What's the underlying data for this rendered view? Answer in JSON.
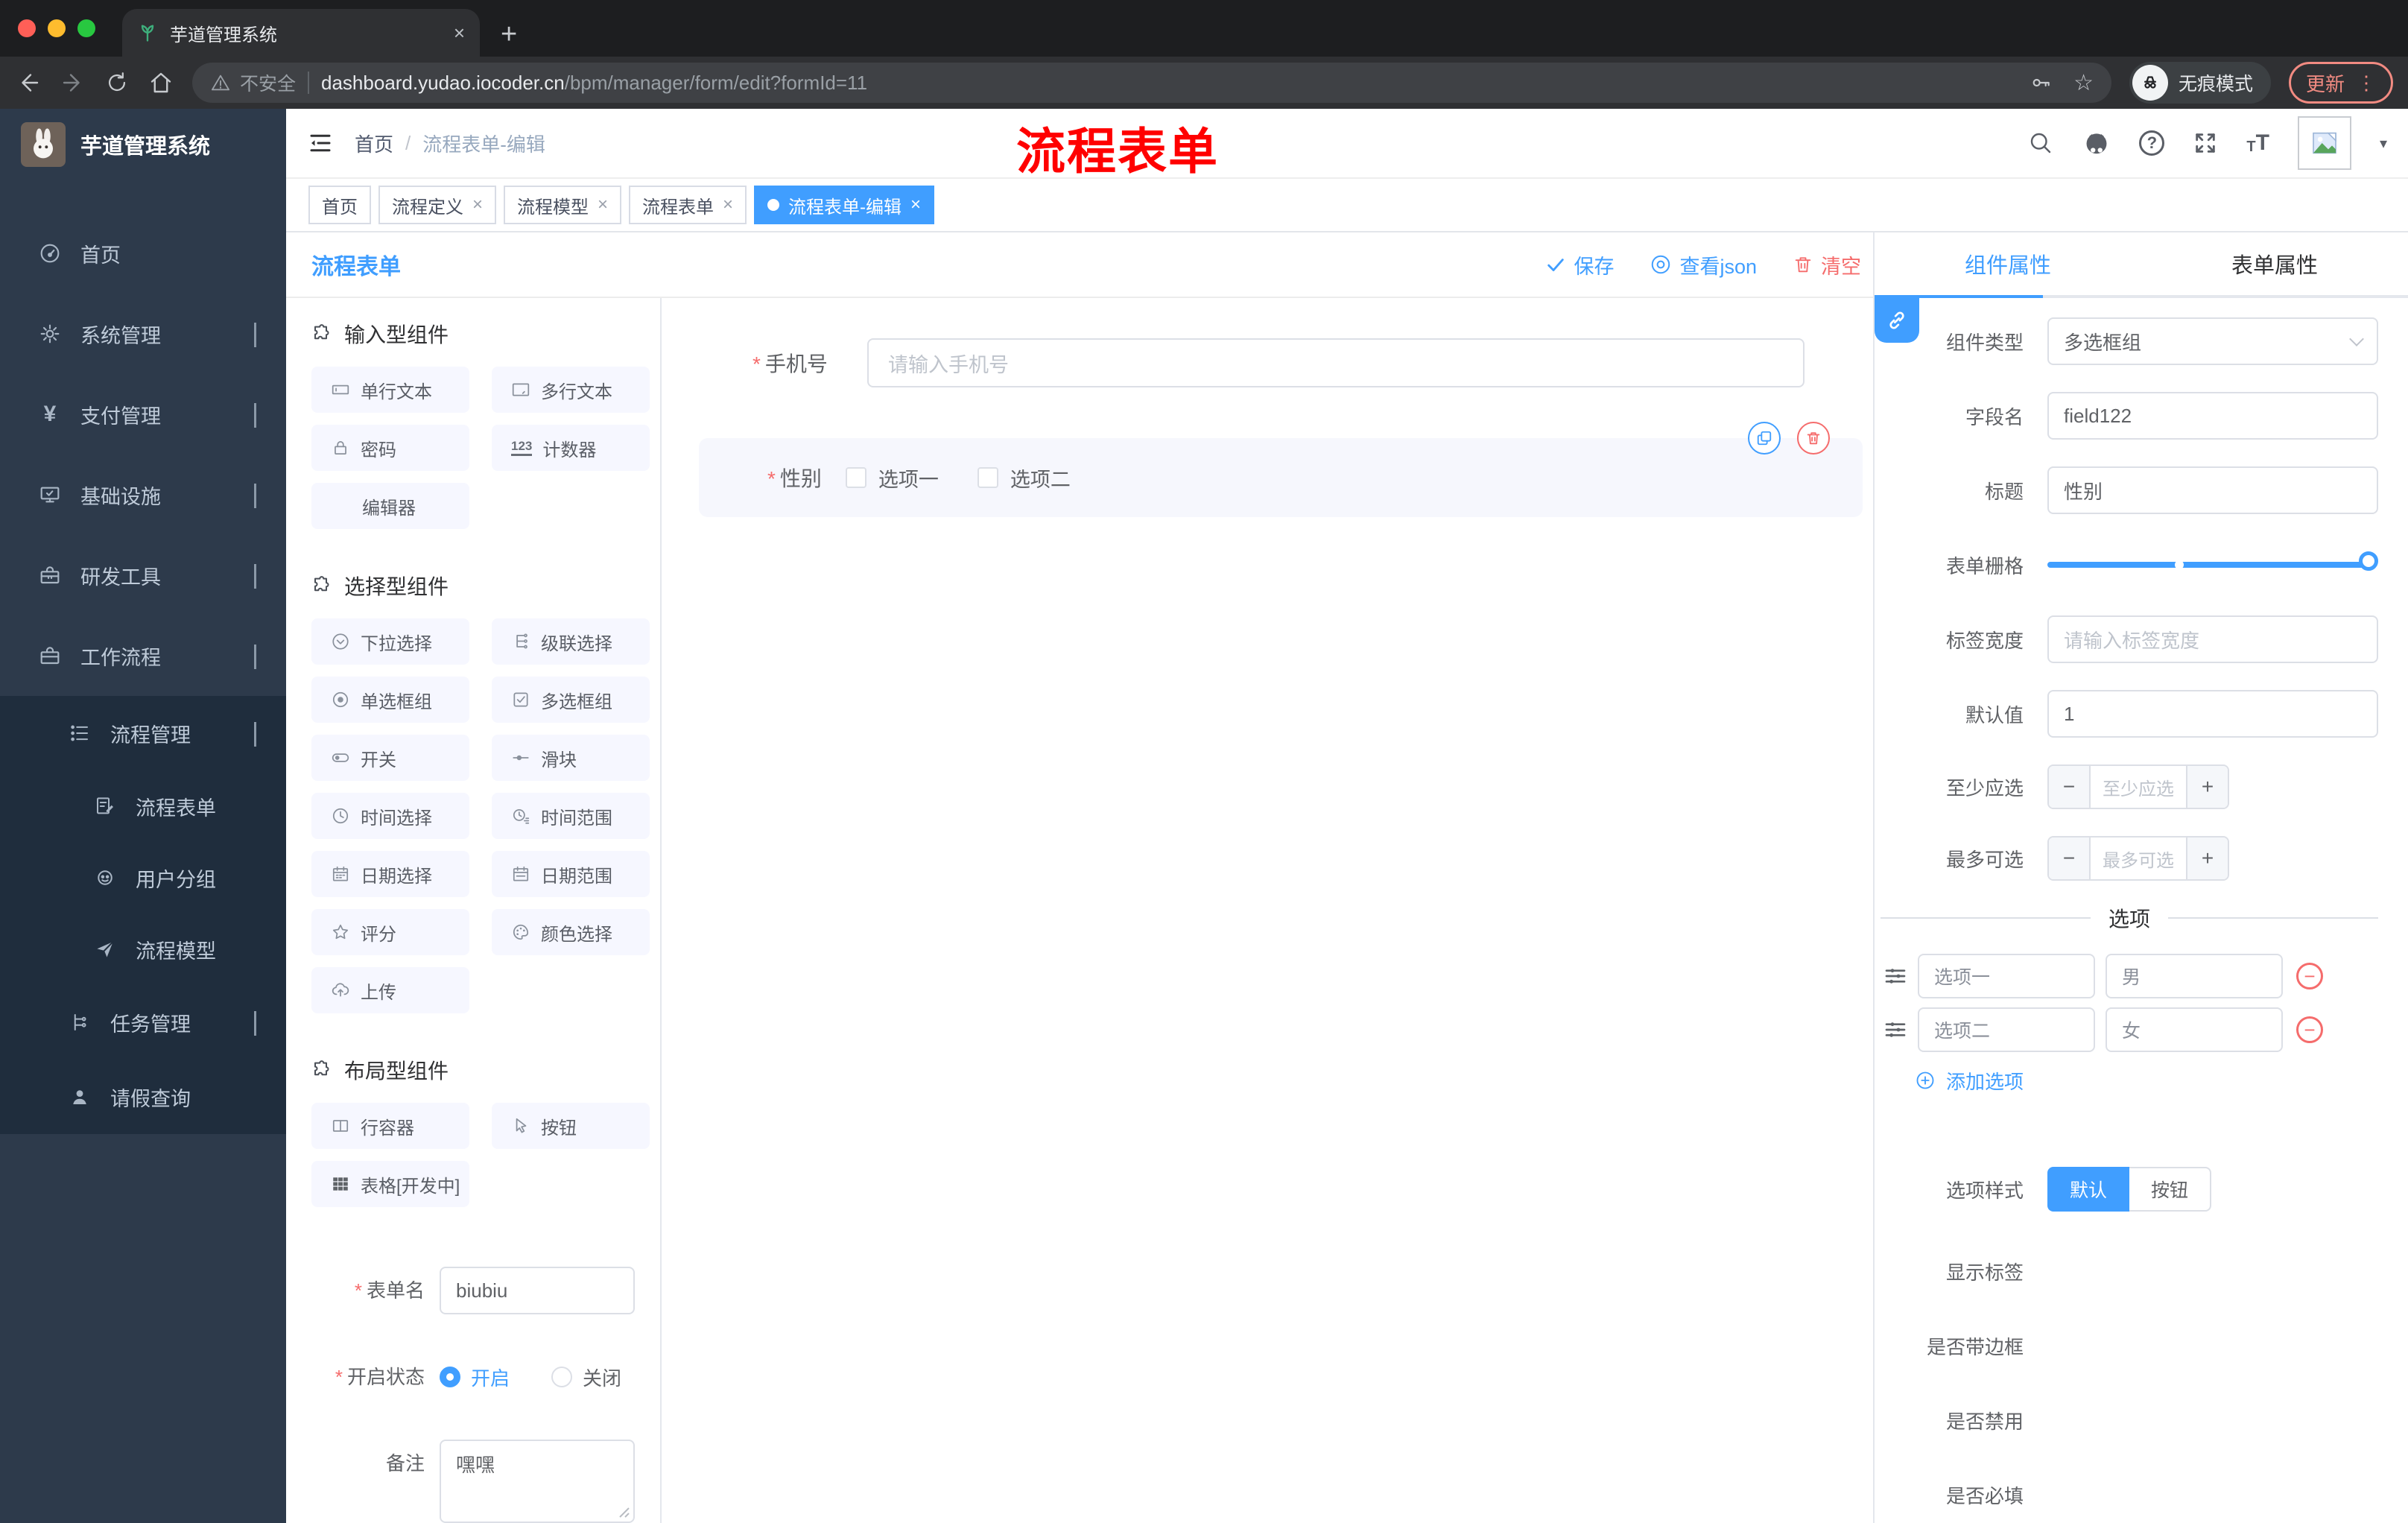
{
  "browser": {
    "tab_title": "芋道管理系统",
    "insecure": "不安全",
    "url_host": "dashboard.yudao.iocoder.cn",
    "url_path": "/bpm/manager/form/edit?formId=11",
    "incognito": "无痕模式",
    "update": "更新"
  },
  "icons": {
    "close": "×",
    "minus": "−",
    "plus": "+",
    "dots": "⋮",
    "star": "☆",
    "question": "?",
    "caret": "▾",
    "counter": "123",
    "yen": "¥",
    "font_big": "T",
    "font_small": "T",
    "warning": "!"
  },
  "sidebar": {
    "app_title": "芋道管理系统",
    "menu": [
      {
        "label": "首页"
      },
      {
        "label": "系统管理"
      },
      {
        "label": "支付管理"
      },
      {
        "label": "基础设施"
      },
      {
        "label": "研发工具"
      },
      {
        "label": "工作流程"
      }
    ],
    "submenu": [
      {
        "label": "流程管理"
      },
      {
        "label": "流程表单"
      },
      {
        "label": "用户分组"
      },
      {
        "label": "流程模型"
      },
      {
        "label": "任务管理"
      },
      {
        "label": "请假查询"
      }
    ]
  },
  "header": {
    "breadcrumb_home": "首页",
    "breadcrumb_sep": "/",
    "breadcrumb_current": "流程表单-编辑",
    "watermark": "流程表单"
  },
  "tags": {
    "t0": "首页",
    "t1": "流程定义",
    "t2": "流程模型",
    "t3": "流程表单",
    "t4": "流程表单-编辑"
  },
  "toolbar": {
    "title": "流程表单",
    "save": "保存",
    "view_json": "查看json",
    "clear": "清空"
  },
  "components": {
    "g1_title": "输入型组件",
    "g1": [
      "单行文本",
      "多行文本",
      "密码",
      "计数器",
      "编辑器"
    ],
    "g2_title": "选择型组件",
    "g2": [
      "下拉选择",
      "级联选择",
      "单选框组",
      "多选框组",
      "开关",
      "滑块",
      "时间选择",
      "时间范围",
      "日期选择",
      "日期范围",
      "评分",
      "颜色选择",
      "上传"
    ],
    "g3_title": "布局型组件",
    "g3": [
      "行容器",
      "按钮",
      "表格[开发中]"
    ]
  },
  "meta": {
    "name_label": "表单名",
    "name_value": "biubiu",
    "status_label": "开启状态",
    "status_on": "开启",
    "status_off": "关闭",
    "remark_label": "备注",
    "remark_value": "嘿嘿"
  },
  "canvas": {
    "phone_label": "手机号",
    "phone_placeholder": "请输入手机号",
    "gender_label": "性别",
    "opt1": "选项一",
    "opt2": "选项二"
  },
  "props": {
    "tab_component": "组件属性",
    "tab_form": "表单属性",
    "type_label": "组件类型",
    "type_value": "多选框组",
    "field_label": "字段名",
    "field_value": "field122",
    "title_label": "标题",
    "title_value": "性别",
    "grid_label": "表单栅格",
    "labelw_label": "标签宽度",
    "labelw_placeholder": "请输入标签宽度",
    "default_label": "默认值",
    "default_value": "1",
    "min_label": "至少应选",
    "min_placeholder": "至少应选",
    "max_label": "最多可选",
    "max_placeholder": "最多可选",
    "divider": "选项",
    "opt_rows": [
      {
        "label": "选项一",
        "value": "男"
      },
      {
        "label": "选项二",
        "value": "女"
      }
    ],
    "add_option": "添加选项",
    "style_label": "选项样式",
    "style_default": "默认",
    "style_button": "按钮",
    "toggle_show": "显示标签",
    "toggle_border": "是否带边框",
    "toggle_disabled": "是否禁用",
    "toggle_required": "是否必填"
  }
}
